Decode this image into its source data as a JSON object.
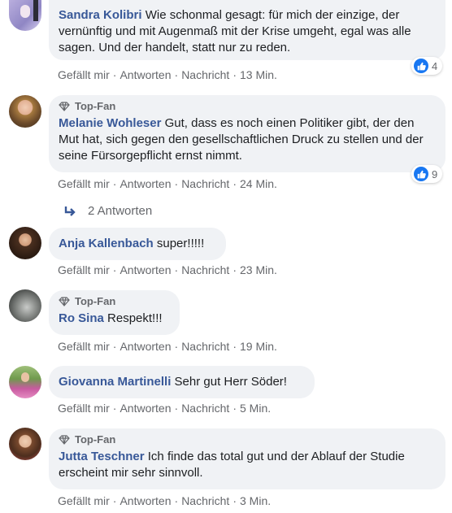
{
  "actions": {
    "like": "Gefällt mir",
    "reply": "Antworten",
    "message": "Nachricht",
    "sep": "·"
  },
  "comments": [
    {
      "top_fan": "",
      "author": "Sandra Kolibri",
      "text": "Wie schonmal gesagt: für mich der einzige, der vernünftig und mit Augenmaß mit der Krise umgeht, egal was alle sagen. Und der handelt, statt nur zu reden.",
      "time": "13 Min.",
      "reactions": "4"
    },
    {
      "top_fan": "Top-Fan",
      "author": "Melanie Wohleser",
      "text": "Gut, dass es noch einen Politiker gibt, der den Mut hat, sich gegen den gesellschaftlichen Druck zu stellen und der seine Fürsorgepflicht ernst nimmt.",
      "time": "24 Min.",
      "reactions": "9",
      "replies": "2 Antworten"
    },
    {
      "top_fan": "",
      "author": "Anja Kallenbach",
      "text": "super!!!!!",
      "time": "23 Min."
    },
    {
      "top_fan": "Top-Fan",
      "author": "Ro Sina",
      "text": "Respekt!!!",
      "time": "19 Min."
    },
    {
      "top_fan": "",
      "author": "Giovanna Martinelli",
      "text": "Sehr gut Herr Söder!",
      "time": "5 Min."
    },
    {
      "top_fan": "Top-Fan",
      "author": "Jutta Teschner",
      "text": "Ich finde das total gut und der Ablauf der Studie erscheint mir sehr sinnvoll.",
      "time": "3 Min."
    }
  ]
}
